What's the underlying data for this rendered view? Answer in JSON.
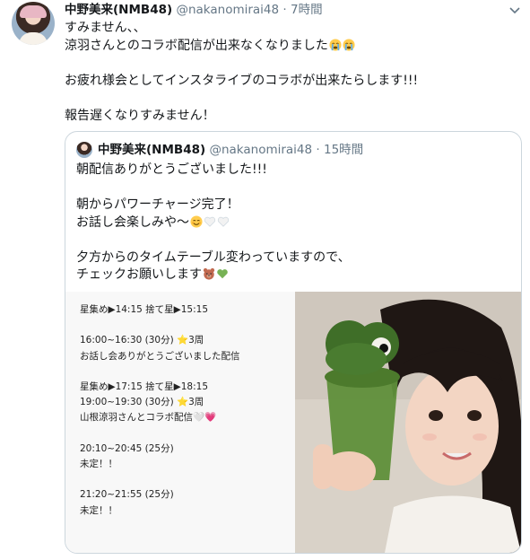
{
  "tweet": {
    "author_name": "中野美来(NMB48)",
    "handle": "@nakanomirai48",
    "separator": "·",
    "time": "7時間",
    "avatar_icon": "profile-avatar",
    "menu_icon": "chevron-down-icon",
    "text_lines": [
      "すみません、、",
      "涼羽さんとのコラボ配信が出来なくなりました",
      "",
      "お疲れ様会としてインスタライブのコラボが出来たらします!!!",
      "",
      "報告遅くなりすみません！"
    ],
    "emoji_after_line_2": [
      "loudly-crying-face",
      "loudly-crying-face"
    ]
  },
  "quoted": {
    "author_name": "中野美来(NMB48)",
    "handle": "@nakanomirai48",
    "separator": "·",
    "time": "15時間",
    "text_lines": [
      "朝配信ありがとうございました!!!",
      "",
      "朝からパワーチャージ完了！",
      "お話し会楽しみや～",
      "",
      "夕方からのタイムテーブル変わっていますので、",
      "チェックお願いします"
    ],
    "emoji_after_line_4": [
      "smiling-face-with-smiling-eyes",
      "white-heart",
      "white-heart"
    ],
    "emoji_after_line_7": [
      "bear-face",
      "green-heart"
    ],
    "schedule_lines": [
      "星集め▶14:15 捨て星▶15:15",
      "",
      "16:00~16:30 (30分) ⭐3周",
      "お話し会ありがとうございました配信",
      "",
      "星集め▶17:15 捨て星▶18:15",
      " 19:00~19:30 (30分) ⭐3周",
      "山根涼羽さんとコラボ配信🤍💗",
      "",
      "20:10~20:45 (25分)",
      "未定！！",
      "",
      "21:20~21:55 (25分)",
      "未定！！"
    ],
    "photo_description_icon": "selfie-photo"
  },
  "colors": {
    "text": "#14171a",
    "secondary": "#657786",
    "border": "#ccd6dd",
    "schedule_bg": "#f8f8f8"
  }
}
